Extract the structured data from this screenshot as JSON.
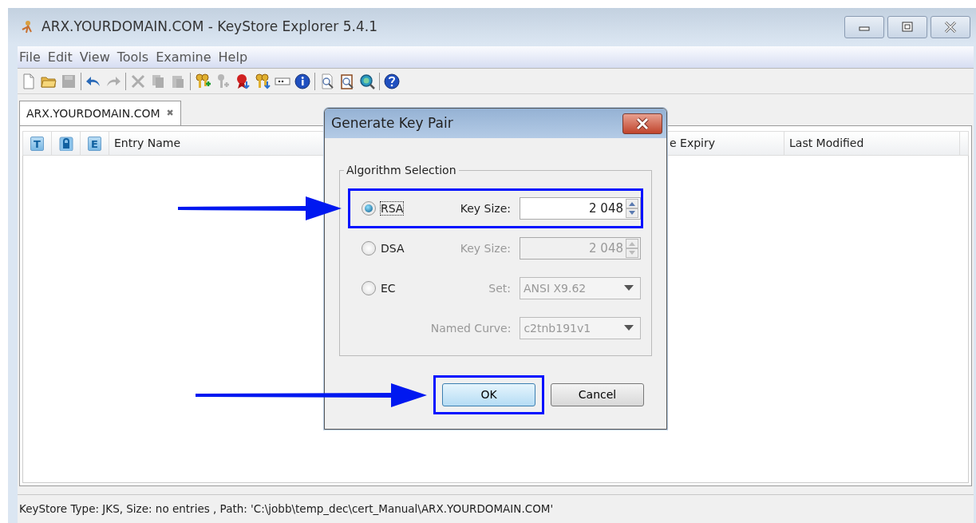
{
  "window": {
    "title": "ARX.YOURDOMAIN.COM - KeyStore Explorer 5.4.1"
  },
  "menu": [
    "File",
    "Edit",
    "View",
    "Tools",
    "Examine",
    "Help"
  ],
  "toolbar": {
    "groups": [
      [
        {
          "kind": "new",
          "disabled": false
        },
        {
          "kind": "open",
          "disabled": false
        },
        {
          "kind": "save",
          "disabled": true
        }
      ],
      [
        {
          "kind": "undo",
          "disabled": false
        },
        {
          "kind": "redo",
          "disabled": true
        }
      ],
      [
        {
          "kind": "cut",
          "disabled": true
        },
        {
          "kind": "copy",
          "disabled": true
        },
        {
          "kind": "paste",
          "disabled": true
        }
      ],
      [
        {
          "kind": "gen-keypair",
          "disabled": false
        },
        {
          "kind": "gen-secret",
          "disabled": true
        },
        {
          "kind": "import-cert",
          "disabled": false
        },
        {
          "kind": "import-keypair",
          "disabled": false
        },
        {
          "kind": "password",
          "disabled": false
        },
        {
          "kind": "info",
          "disabled": false
        }
      ],
      [
        {
          "kind": "examine-file",
          "disabled": false
        },
        {
          "kind": "examine-clipboard",
          "disabled": false
        },
        {
          "kind": "examine-ssl",
          "disabled": false
        }
      ],
      [
        {
          "kind": "help",
          "disabled": false
        }
      ]
    ]
  },
  "tabs": [
    {
      "label": "ARX.YOURDOMAIN.COM",
      "close": "✖",
      "selected": true
    }
  ],
  "table": {
    "columns": [
      {
        "kind": "icon",
        "label": "T"
      },
      {
        "kind": "lock"
      },
      {
        "kind": "icon",
        "label": "E"
      },
      {
        "kind": "text",
        "label": "Entry Name"
      },
      {
        "kind": "text",
        "label": "e Expiry"
      },
      {
        "kind": "text",
        "label": "Last Modified"
      }
    ]
  },
  "status_bar": "KeyStore Type: JKS, Size: no entries , Path: 'C:\\jobb\\temp_dec\\cert_Manual\\ARX.YOURDOMAIN.COM'",
  "dialog": {
    "title": "Generate Key Pair",
    "group_title": "Algorithm Selection",
    "rows": [
      {
        "kind": "spinner",
        "option": "RSA",
        "selected": true,
        "label": "Key Size:",
        "value": "2 048",
        "disabled": false,
        "highlighted": true
      },
      {
        "kind": "spinner",
        "option": "DSA",
        "selected": false,
        "label": "Key Size:",
        "value": "2 048",
        "disabled": true,
        "highlighted": false
      },
      {
        "kind": "combo",
        "option": "EC",
        "selected": false,
        "label": "Set:",
        "value": "ANSI X9.62",
        "disabled": true,
        "highlighted": false
      },
      {
        "kind": "combo",
        "label": "Named Curve:",
        "value": "c2tnb191v1",
        "disabled": true,
        "highlighted": false
      }
    ],
    "buttons": [
      {
        "label": "OK",
        "default": true,
        "highlighted": true
      },
      {
        "label": "Cancel",
        "default": false,
        "highlighted": false
      }
    ]
  }
}
